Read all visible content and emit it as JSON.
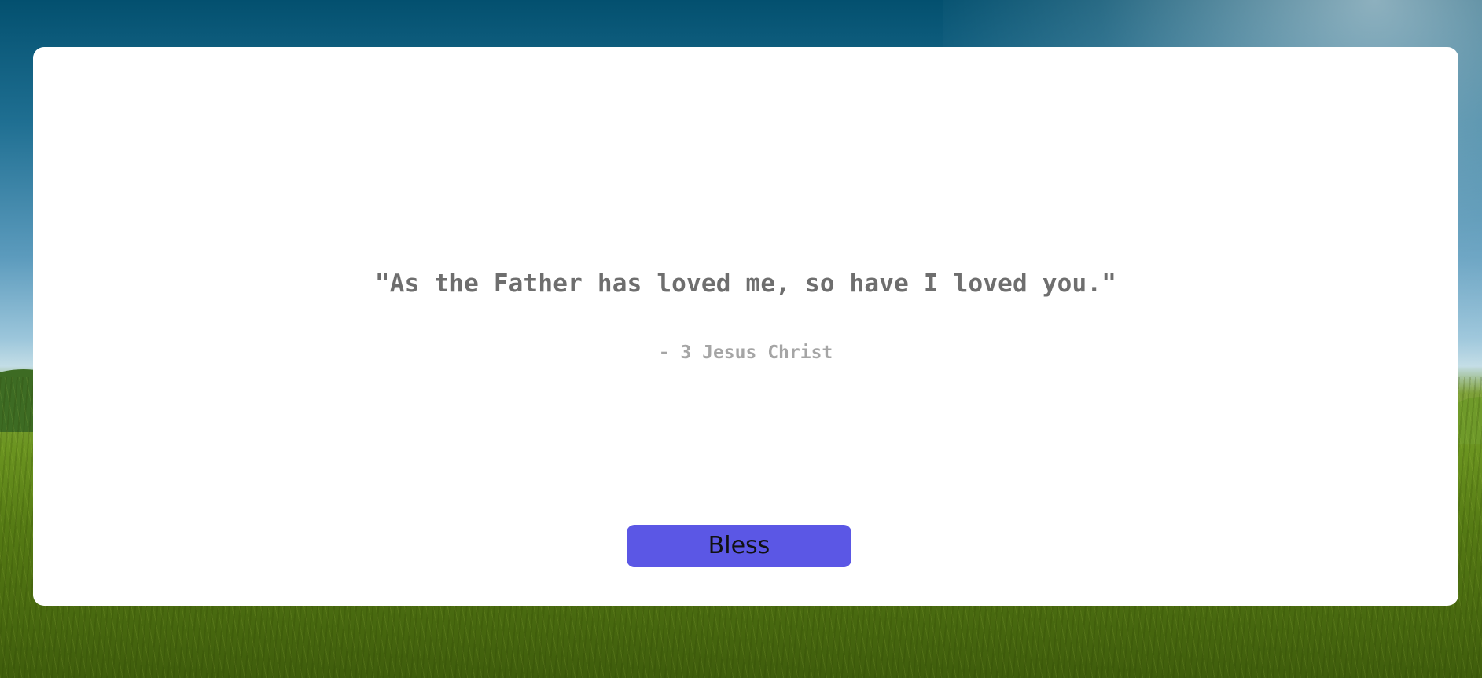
{
  "quote": {
    "text": "\"As the Father has loved me, so have I loved you.\"",
    "author": "- 3 Jesus Christ"
  },
  "actions": {
    "bless_label": "Bless"
  },
  "colors": {
    "button_bg": "#5b57e5",
    "quote_text": "#6e6e6e",
    "author_text": "#a5a5a5",
    "card_bg": "#ffffff"
  }
}
